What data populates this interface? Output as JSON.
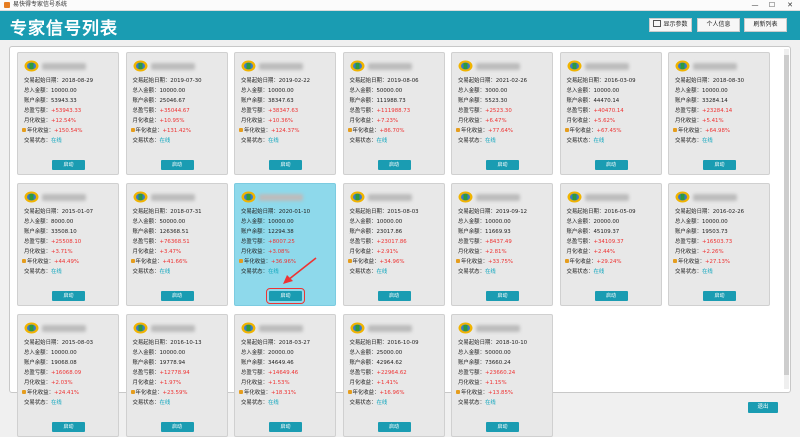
{
  "window": {
    "title": "易快得专家信号系统",
    "minimize": "—",
    "maximize": "☐",
    "close": "✕"
  },
  "header": {
    "title": "专家信号列表",
    "buttons": {
      "show_params": "显示参数",
      "personal_info": "个人信息",
      "refresh_list": "刷新列表"
    }
  },
  "labels": {
    "start_date": "交易起始日期：",
    "total_deposit": "总入金额：",
    "balance": "账户余额：",
    "profit": "总盈亏额：",
    "monthly": "月化收益：",
    "annual": "年化收益：",
    "status": "交易状态："
  },
  "launch_label": "启动",
  "footer": {
    "exit": "退出"
  },
  "brand_color": "#1a9cb2",
  "cards": [
    {
      "start_date": "2018-08-29",
      "total_deposit": "10000.00",
      "balance": "53943.33",
      "profit": "+53943.33",
      "monthly": "+12.54%",
      "annual": "+150.54%",
      "status": "在线"
    },
    {
      "start_date": "2019-07-30",
      "total_deposit": "10000.00",
      "balance": "25046.67",
      "profit": "+35044.67",
      "monthly": "+10.95%",
      "annual": "+131.42%",
      "status": "在线"
    },
    {
      "start_date": "2019-02-22",
      "total_deposit": "10000.00",
      "balance": "38347.63",
      "profit": "+38347.63",
      "monthly": "+10.36%",
      "annual": "+124.37%",
      "status": "在线"
    },
    {
      "start_date": "2019-08-06",
      "total_deposit": "50000.00",
      "balance": "111988.73",
      "profit": "+111988.73",
      "monthly": "+7.23%",
      "annual": "+86.70%",
      "status": "在线"
    },
    {
      "start_date": "2021-02-26",
      "total_deposit": "3000.00",
      "balance": "5523.30",
      "profit": "+2523.30",
      "monthly": "+6.47%",
      "annual": "+77.64%",
      "status": "在线"
    },
    {
      "start_date": "2016-03-09",
      "total_deposit": "10000.00",
      "balance": "44470.14",
      "profit": "+40470.14",
      "monthly": "+5.62%",
      "annual": "+67.45%",
      "status": "在线"
    },
    {
      "start_date": "2018-08-30",
      "total_deposit": "10000.00",
      "balance": "33284.14",
      "profit": "+23284.14",
      "monthly": "+5.41%",
      "annual": "+64.98%",
      "status": "在线"
    },
    {
      "start_date": "2015-01-07",
      "total_deposit": "8000.00",
      "balance": "33508.10",
      "profit": "+25508.10",
      "monthly": "+3.71%",
      "annual": "+44.49%",
      "status": "在线"
    },
    {
      "start_date": "2018-07-31",
      "total_deposit": "50000.00",
      "balance": "126368.51",
      "profit": "+76368.51",
      "monthly": "+3.47%",
      "annual": "+41.66%",
      "status": "在线"
    },
    {
      "start_date": "2020-01-10",
      "total_deposit": "10000.00",
      "balance": "12294.38",
      "profit": "+8007.25",
      "monthly": "+3.08%",
      "annual": "+36.96%",
      "status": "在线"
    },
    {
      "start_date": "2015-08-03",
      "total_deposit": "10000.00",
      "balance": "23017.86",
      "profit": "+23017.86",
      "monthly": "+2.91%",
      "annual": "+34.96%",
      "status": "在线"
    },
    {
      "start_date": "2019-09-12",
      "total_deposit": "10000.00",
      "balance": "11669.93",
      "profit": "+8437.49",
      "monthly": "+2.81%",
      "annual": "+33.75%",
      "status": "在线"
    },
    {
      "start_date": "2016-05-09",
      "total_deposit": "20000.00",
      "balance": "45109.37",
      "profit": "+34109.37",
      "monthly": "+2.44%",
      "annual": "+29.24%",
      "status": "在线"
    },
    {
      "start_date": "2016-02-26",
      "total_deposit": "10000.00",
      "balance": "19503.73",
      "profit": "+16503.73",
      "monthly": "+2.26%",
      "annual": "+27.13%",
      "status": "在线"
    },
    {
      "start_date": "2015-08-03",
      "total_deposit": "10000.00",
      "balance": "19068.08",
      "profit": "+16068.09",
      "monthly": "+2.03%",
      "annual": "+24.41%",
      "status": "在线"
    },
    {
      "start_date": "2016-10-13",
      "total_deposit": "10000.00",
      "balance": "19778.94",
      "profit": "+12778.94",
      "monthly": "+1.97%",
      "annual": "+23.59%",
      "status": "在线"
    },
    {
      "start_date": "2018-03-27",
      "total_deposit": "20000.00",
      "balance": "34649.46",
      "profit": "+14649.46",
      "monthly": "+1.53%",
      "annual": "+18.31%",
      "status": "在线"
    },
    {
      "start_date": "2016-10-09",
      "total_deposit": "25000.00",
      "balance": "42964.62",
      "profit": "+22964.62",
      "monthly": "+1.41%",
      "annual": "+16.96%",
      "status": "在线"
    },
    {
      "start_date": "2018-10-10",
      "total_deposit": "50000.00",
      "balance": "73660.24",
      "profit": "+23660.24",
      "monthly": "+1.15%",
      "annual": "+13.85%",
      "status": "在线"
    }
  ]
}
